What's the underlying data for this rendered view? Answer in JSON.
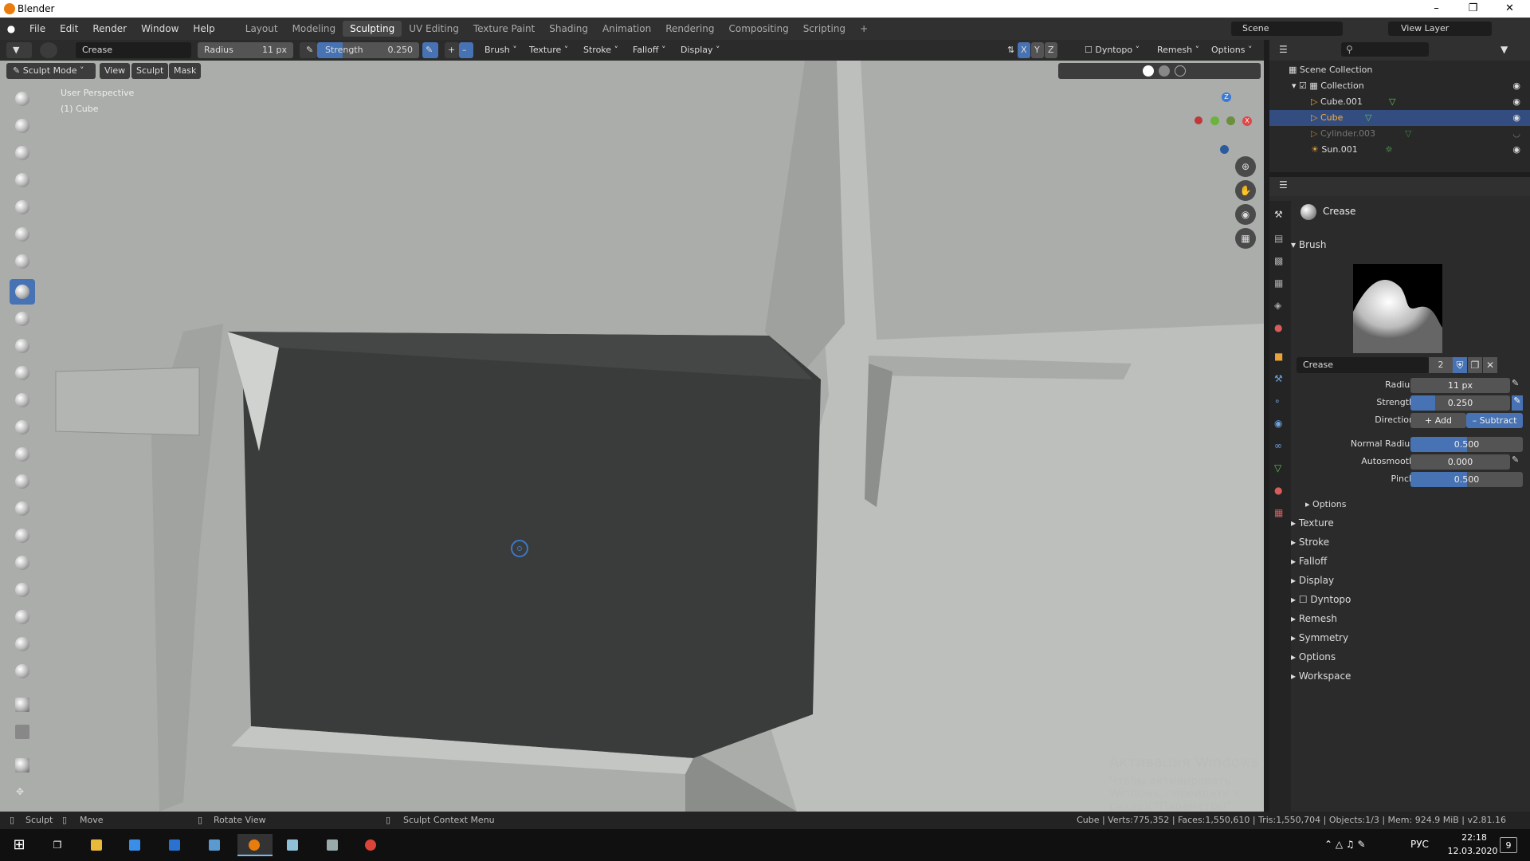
{
  "window": {
    "title": "Blender"
  },
  "menu": [
    "File",
    "Edit",
    "Render",
    "Window",
    "Help"
  ],
  "workspaces": [
    "Layout",
    "Modeling",
    "Sculpting",
    "UV Editing",
    "Texture Paint",
    "Shading",
    "Animation",
    "Rendering",
    "Compositing",
    "Scripting"
  ],
  "active_workspace": "Sculpting",
  "scene": {
    "scene_name": "Scene",
    "view_layer": "View Layer"
  },
  "tool_header": {
    "brush_name": "Crease",
    "radius_label": "Radius",
    "radius_value": "11 px",
    "strength_label": "Strength",
    "strength_value": "0.250",
    "strength_fraction": 0.25,
    "dropdowns": [
      "Brush",
      "Texture",
      "Stroke",
      "Falloff",
      "Display"
    ],
    "axes": [
      "X",
      "Y",
      "Z"
    ],
    "right": [
      "Dyntopo",
      "Remesh",
      "Options"
    ]
  },
  "mode_header": {
    "mode": "Sculpt Mode",
    "menus": [
      "View",
      "Sculpt",
      "Mask"
    ]
  },
  "viewport": {
    "perspective": "User Perspective",
    "object": "(1) Cube",
    "gizmo": {
      "z": "Z",
      "x": "X"
    },
    "watermark_title": "Активация Windows",
    "watermark_text": "Чтобы активировать Windows, перейдите в раздел \"Параметры\"."
  },
  "outliner": {
    "root": "Scene Collection",
    "items": [
      {
        "name": "Collection",
        "level": 1
      },
      {
        "name": "Cube.001",
        "level": 2
      },
      {
        "name": "Cube",
        "level": 2,
        "selected": true
      },
      {
        "name": "Cylinder.003",
        "level": 2,
        "dim": true
      },
      {
        "name": "Sun.001",
        "level": 2
      }
    ]
  },
  "properties": {
    "brush_title": "Crease",
    "brush_section": "Brush",
    "brush_name": "Crease",
    "brush_users": "2",
    "radius_label": "Radius",
    "radius_value": "11 px",
    "strength_label": "Strength",
    "strength_value": "0.250",
    "strength_fraction": 0.25,
    "direction_label": "Direction",
    "direction_add": "Add",
    "direction_subtract": "Subtract",
    "normal_radius_label": "Normal Radius",
    "normal_radius_value": "0.500",
    "normal_radius_fraction": 0.5,
    "autosmooth_label": "Autosmooth",
    "autosmooth_value": "0.000",
    "pinch_label": "Pinch",
    "pinch_value": "0.500",
    "pinch_fraction": 0.5,
    "options_sub": "Options",
    "panels": [
      "Texture",
      "Stroke",
      "Falloff",
      "Display",
      "Dyntopo",
      "Remesh",
      "Symmetry",
      "Options",
      "Workspace"
    ]
  },
  "statusbar": {
    "left": [
      "Sculpt",
      "Move",
      "Rotate View",
      "Sculpt Context Menu"
    ],
    "stats": "Cube | Verts:775,352 | Faces:1,550,610 | Tris:1,550,704 | Objects:1/3 | Mem: 924.9 MiB | v2.81.16"
  },
  "taskbar": {
    "lang": "РУС",
    "time": "22:18",
    "date": "12.03.2020",
    "notifications": "9"
  }
}
